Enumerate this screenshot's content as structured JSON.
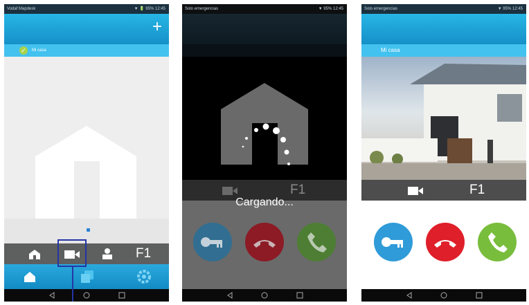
{
  "phone_list": {
    "status_left": "Vodaf Mapdesk",
    "status_right": "▼ 🔋 95% 12:45",
    "house_name": "Mi casa",
    "intercom_label": "F1"
  },
  "phone_loading": {
    "status_left": "Solo emergencias",
    "status_right": "▼ 95% 12:45",
    "loading_text": "Cargando...",
    "intercom_label": "F1"
  },
  "phone_video": {
    "status_left": "Solo emergencias",
    "status_right": "▼ 95% 12:45",
    "house_name": "Mi casa",
    "intercom_label": "F1"
  },
  "colors": {
    "header_blue": "#1c9fd6",
    "accent_blue": "#2b84d6",
    "highlight_navy": "#2535a4",
    "key_blue": "#2f9bd8",
    "hangup_red": "#df1f2a",
    "answer_green": "#79bd3c"
  },
  "icons": [
    "home-icon",
    "camera-icon",
    "person-icon",
    "key-icon",
    "hangup-icon",
    "phone-icon",
    "gear-icon",
    "copy-icon",
    "plus-icon"
  ]
}
